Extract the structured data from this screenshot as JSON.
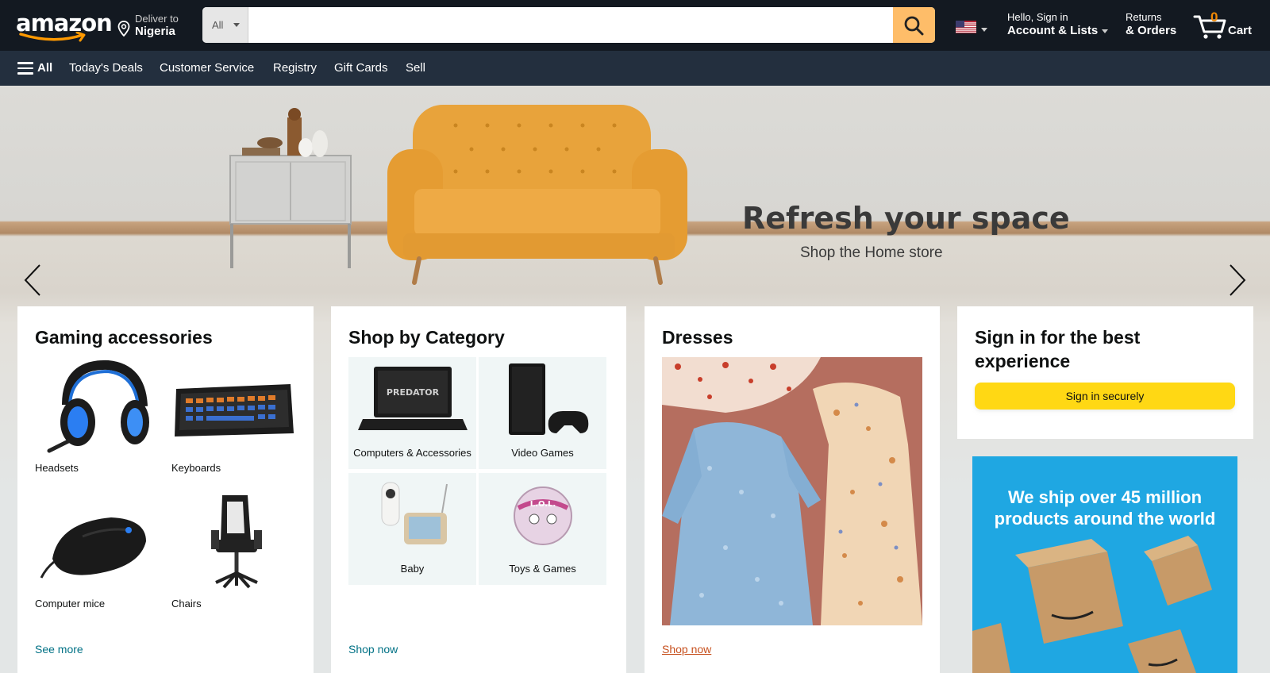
{
  "header": {
    "logo_text": "amazon",
    "deliver_line1": "Deliver to",
    "deliver_line2": "Nigeria",
    "search_category": "All",
    "search_placeholder": "",
    "account_line1": "Hello, Sign in",
    "account_line2": "Account & Lists",
    "returns_line1": "Returns",
    "returns_line2": "& Orders",
    "cart_count": "0",
    "cart_label": "Cart"
  },
  "nav": {
    "all_label": "All",
    "items": [
      "Today's Deals",
      "Customer Service",
      "Registry",
      "Gift Cards",
      "Sell"
    ]
  },
  "hero": {
    "title": "Refresh your space",
    "subtitle": "Shop the Home store"
  },
  "cards": {
    "gaming": {
      "title": "Gaming accessories",
      "items": [
        "Headsets",
        "Keyboards",
        "Computer mice",
        "Chairs"
      ],
      "link": "See more"
    },
    "category": {
      "title": "Shop by Category",
      "items": [
        "Computers & Accessories",
        "Video Games",
        "Baby",
        "Toys & Games"
      ],
      "link": "Shop now"
    },
    "dresses": {
      "title": "Dresses",
      "link": "Shop now"
    },
    "signin": {
      "title": "Sign in for the best experience",
      "button": "Sign in securely"
    },
    "ship": {
      "text": "We ship over 45 million products around the world"
    }
  },
  "colors": {
    "header_bg": "#131921",
    "nav_bg": "#232f3e",
    "search_button": "#febd69",
    "signin_button": "#ffd814",
    "link": "#007185",
    "cart_count": "#f08804"
  }
}
